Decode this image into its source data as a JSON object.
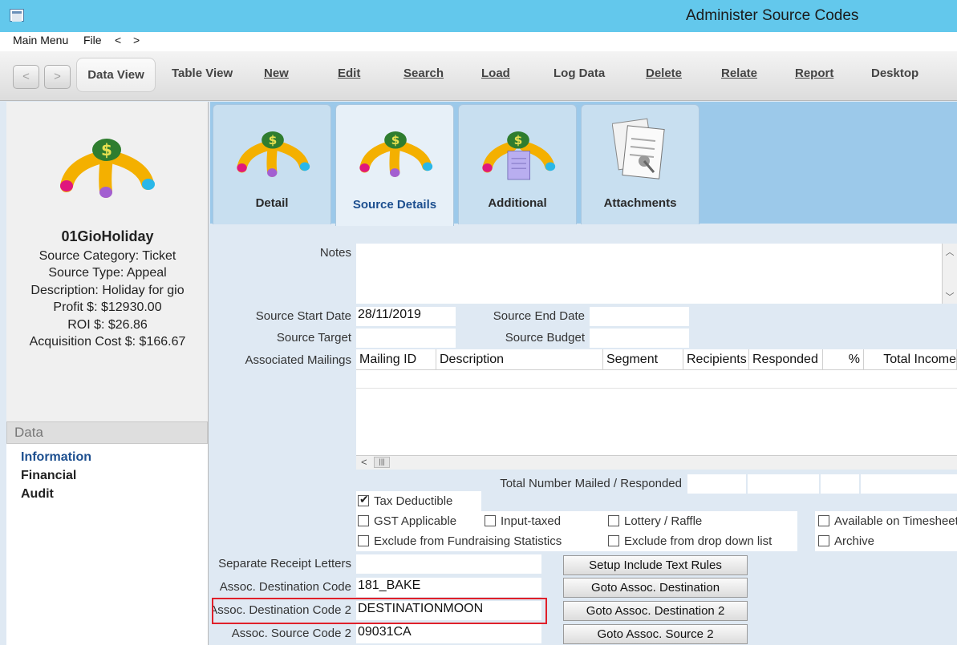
{
  "window": {
    "title": "Administer Source Codes"
  },
  "menubar": {
    "items": [
      "Main Menu",
      "File",
      "<",
      ">"
    ]
  },
  "toolbar": {
    "back": "<",
    "forward": ">",
    "buttons": [
      "Data View",
      "Table View",
      "New",
      "Edit",
      "Search",
      "Load",
      "Log Data",
      "Delete",
      "Relate",
      "Report",
      "Desktop"
    ]
  },
  "sidebar": {
    "code": "01GioHoliday",
    "lines": [
      "Source Category: Ticket",
      "Source Type: Appeal",
      "Description: Holiday for gio",
      "Profit $: $12930.00",
      "ROI $: $26.86",
      "Acquisition Cost $: $166.67"
    ],
    "data_header": "Data",
    "data_items": [
      "Information",
      "Financial",
      "Audit"
    ]
  },
  "tabs": [
    "Detail",
    "Source Details",
    "Additional",
    "Attachments"
  ],
  "form": {
    "notes_label": "Notes",
    "notes_value": "",
    "start_label": "Source Start Date",
    "start_value": "28/11/2019",
    "end_label": "Source End Date",
    "end_value": "",
    "target_label": "Source Target",
    "target_value": "",
    "budget_label": "Source Budget",
    "budget_value": "",
    "mailings_label": "Associated Mailings",
    "mailings_columns": [
      "Mailing ID",
      "Description",
      "Segment",
      "Recipients",
      "Responded",
      "%",
      "Total Income"
    ],
    "total_label": "Total Number Mailed / Responded",
    "checkboxes": [
      {
        "label": "Tax Deductible",
        "checked": true
      },
      {
        "label": "GST Applicable",
        "checked": false
      },
      {
        "label": "Input-taxed",
        "checked": false
      },
      {
        "label": "Lottery / Raffle",
        "checked": false
      },
      {
        "label": "Available on Timesheet",
        "checked": false
      },
      {
        "label": "Exclude from Fundraising Statistics",
        "checked": false
      },
      {
        "label": "Exclude from drop down list",
        "checked": false
      },
      {
        "label": "Archive",
        "checked": false
      }
    ],
    "receipt_label": "Separate Receipt Letters",
    "receipt_value": "",
    "dest_label": "Assoc. Destination Code",
    "dest_value": "181_BAKE",
    "dest2_label": "Assoc. Destination Code 2",
    "dest2_value": "DESTINATIONMOON",
    "src2_label": "Assoc. Source Code 2",
    "src2_value": "09031CA",
    "buttons": [
      "Setup Include Text Rules",
      "Goto Assoc. Destination",
      "Goto Assoc. Destination 2",
      "Goto Assoc. Source 2"
    ]
  },
  "colors": {
    "titlebar": "#63c8ec",
    "highlight": "#e0202a",
    "tabstrip": "#9cc9ea"
  }
}
